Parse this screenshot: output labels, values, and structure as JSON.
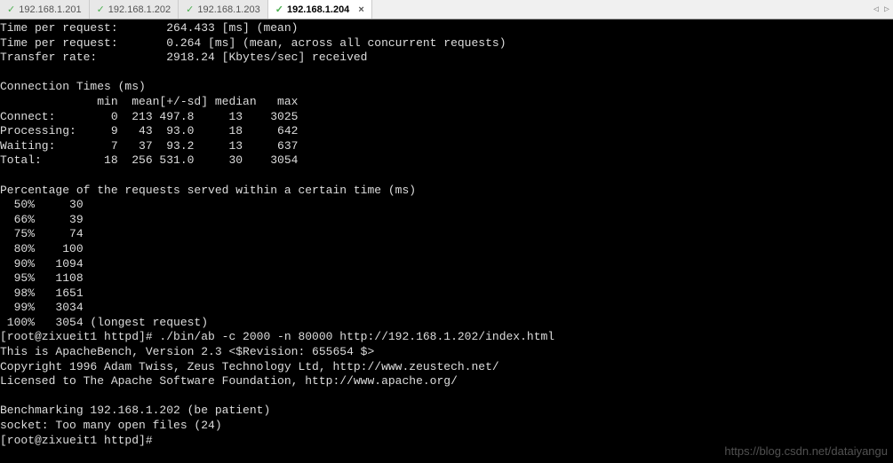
{
  "tabs": [
    {
      "label": "192.168.1.201",
      "active": false
    },
    {
      "label": "192.168.1.202",
      "active": false
    },
    {
      "label": "192.168.1.203",
      "active": false
    },
    {
      "label": "192.168.1.204",
      "active": true
    }
  ],
  "close_glyph": "×",
  "tick_glyph": "✓",
  "arrows": {
    "left": "◁",
    "right": "▷"
  },
  "terminal_lines": [
    "Time per request:       264.433 [ms] (mean)",
    "Time per request:       0.264 [ms] (mean, across all concurrent requests)",
    "Transfer rate:          2918.24 [Kbytes/sec] received",
    "",
    "Connection Times (ms)",
    "              min  mean[+/-sd] median   max",
    "Connect:        0  213 497.8     13    3025",
    "Processing:     9   43  93.0     18     642",
    "Waiting:        7   37  93.2     13     637",
    "Total:         18  256 531.0     30    3054",
    "",
    "Percentage of the requests served within a certain time (ms)",
    "  50%     30",
    "  66%     39",
    "  75%     74",
    "  80%    100",
    "  90%   1094",
    "  95%   1108",
    "  98%   1651",
    "  99%   3034",
    " 100%   3054 (longest request)",
    "[root@zixueit1 httpd]# ./bin/ab -c 2000 -n 80000 http://192.168.1.202/index.html",
    "This is ApacheBench, Version 2.3 <$Revision: 655654 $>",
    "Copyright 1996 Adam Twiss, Zeus Technology Ltd, http://www.zeustech.net/",
    "Licensed to The Apache Software Foundation, http://www.apache.org/",
    "",
    "Benchmarking 192.168.1.202 (be patient)",
    "socket: Too many open files (24)",
    "[root@zixueit1 httpd]#"
  ],
  "watermark": "https://blog.csdn.net/dataiyangu"
}
